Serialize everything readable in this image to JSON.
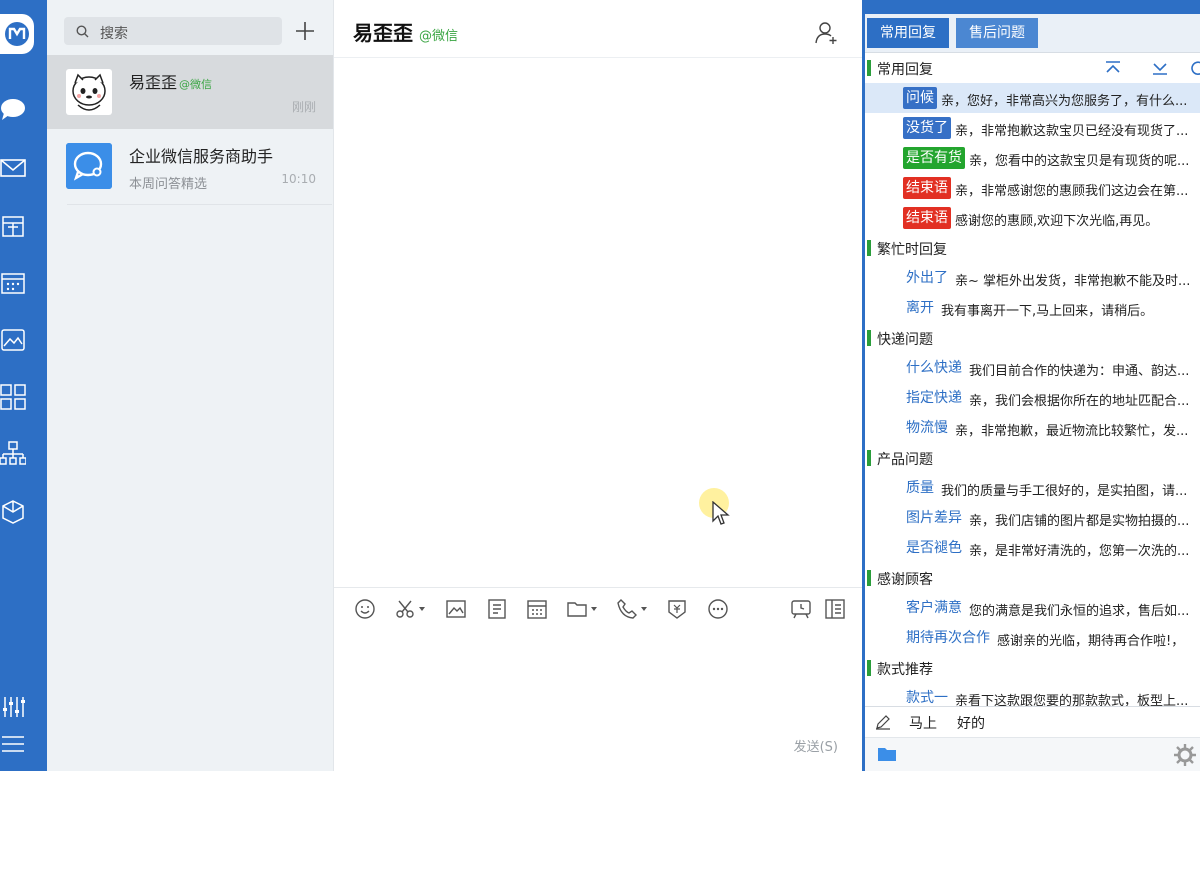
{
  "colors": {
    "rail": "#2d6fc5",
    "accent_green": "#3aa543",
    "tag_blue": "#3670c6",
    "tag_green": "#23a52e",
    "tag_red": "#e23023"
  },
  "sidebar": {
    "icons": [
      "app-logo",
      "chat-icon",
      "mail-icon",
      "shopping-bag-icon",
      "calendar-icon",
      "image-gallery-icon",
      "apps-grid-icon",
      "org-chart-icon",
      "cube-icon",
      "settings-sliders-icon",
      "menu-icon"
    ]
  },
  "search": {
    "placeholder": "搜索"
  },
  "conversations": [
    {
      "name": "易歪歪",
      "tag": "@微信",
      "time": "刚刚",
      "preview": ""
    },
    {
      "name": "企业微信服务商助手",
      "tag": "",
      "time": "10:10",
      "preview": "本周问答精选"
    }
  ],
  "chat": {
    "title": "易歪歪",
    "tag": "@微信",
    "toolbar": [
      "emoji-icon",
      "scissors-icon",
      "image-icon",
      "document-icon",
      "calendar-icon",
      "folder-icon",
      "phone-icon",
      "red-packet-icon",
      "more-icon",
      "screen-record-icon",
      "side-panel-icon"
    ],
    "send_label": "发送(S)"
  },
  "quick_reply": {
    "tabs": [
      "常用回复",
      "售后问题"
    ],
    "sections": [
      {
        "title": "常用回复",
        "items": [
          {
            "key": "问候",
            "style": "blue",
            "text": "亲，您好，非常高兴为您服务了，有什么..."
          },
          {
            "key": "没货了",
            "style": "blue",
            "text": "亲，非常抱歉这款宝贝已经没有现货了..."
          },
          {
            "key": "是否有货",
            "style": "green",
            "text": "亲，您看中的这款宝贝是有现货的呢..."
          },
          {
            "key": "结束语",
            "style": "red",
            "text": "亲，非常感谢您的惠顾我们这边会在第..."
          },
          {
            "key": "结束语",
            "style": "red",
            "text": "感谢您的惠顾,欢迎下次光临,再见。"
          }
        ]
      },
      {
        "title": "繁忙时回复",
        "items": [
          {
            "key": "外出了",
            "style": "plain",
            "text": "亲~ 掌柜外出发货，非常抱歉不能及时..."
          },
          {
            "key": "离开",
            "style": "plain",
            "text": "我有事离开一下,马上回来，请稍后。"
          }
        ]
      },
      {
        "title": "快递问题",
        "items": [
          {
            "key": "什么快递",
            "style": "plain",
            "text": "我们目前合作的快递为：申通、韵达..."
          },
          {
            "key": "指定快递",
            "style": "plain",
            "text": "亲，我们会根据你所在的地址匹配合..."
          },
          {
            "key": "物流慢",
            "style": "plain",
            "text": "亲，非常抱歉，最近物流比较繁忙，发..."
          }
        ]
      },
      {
        "title": "产品问题",
        "items": [
          {
            "key": "质量",
            "style": "plain",
            "text": "我们的质量与手工很好的，是实拍图，请..."
          },
          {
            "key": "图片差异",
            "style": "plain",
            "text": "亲，我们店铺的图片都是实物拍摄的..."
          },
          {
            "key": "是否褪色",
            "style": "plain",
            "text": "亲，是非常好清洗的，您第一次洗的..."
          }
        ]
      },
      {
        "title": "感谢顾客",
        "items": [
          {
            "key": "客户满意",
            "style": "plain",
            "text": "您的满意是我们永恒的追求，售后如..."
          },
          {
            "key": "期待再次合作",
            "style": "plain",
            "text": "感谢亲的光临，期待再合作啦!，"
          }
        ]
      },
      {
        "title": "款式推荐",
        "items": [
          {
            "key": "款式一",
            "style": "plain",
            "text": "亲看下这款跟您要的那款款式，板型上..."
          }
        ]
      }
    ],
    "suggestions": [
      "马上",
      "好的"
    ]
  }
}
